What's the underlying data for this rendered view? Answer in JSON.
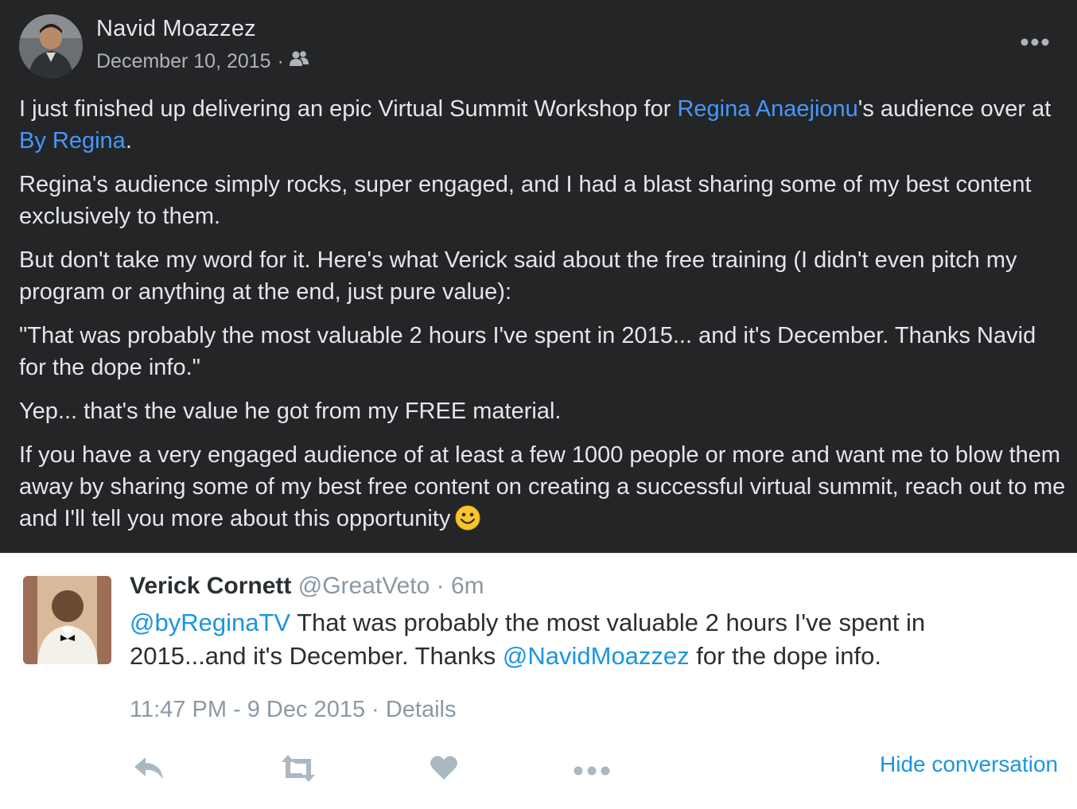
{
  "post": {
    "author": "Navid Moazzez",
    "date": "December 10, 2015",
    "date_separator": "·",
    "audience_icon": "friends-icon",
    "more_icon": "more-options-icon",
    "body": {
      "p1_a": "I just finished up delivering an epic Virtual Summit Workshop for ",
      "p1_link1": "Regina Anaejionu",
      "p1_b": "'s audience over at ",
      "p1_link2": "By Regina",
      "p1_c": ".",
      "p2": "Regina's audience simply rocks, super engaged, and I had a blast sharing some of my best content exclusively to them.",
      "p3": "But don't take my word for it. Here's what Verick said about the free training (I didn't even pitch my program or anything at the end, just pure value):",
      "p4": "\"That was probably the most valuable 2 hours I've spent in 2015... and it's December. Thanks Navid for the dope info.\"",
      "p5": "Yep... that's the value he got from my FREE material.",
      "p6": "If you have a very engaged audience of at least a few 1000 people or more and want me to blow them away by sharing some of my best free content on creating a successful virtual summit, reach out to me and I'll tell you more about this opportunity",
      "emoji_icon": "smiley-emoji-icon"
    },
    "colors": {
      "background": "#242526",
      "text": "#e4e6eb",
      "secondary": "#b0b3b8",
      "link": "#4599ff"
    }
  },
  "tweet": {
    "name": "Verick Cornett",
    "handle": "@GreatVeto",
    "separator": "·",
    "time_ago": "6m",
    "mention1": "@byReginaTV",
    "text_a": " That was probably the most valuable 2 hours I've spent in 2015...and it's December. Thanks ",
    "mention2": "@NavidMoazzez",
    "text_b": " for the dope info.",
    "timestamp": "11:47 PM - 9 Dec 2015 · Details",
    "actions": [
      "reply-icon",
      "retweet-icon",
      "like-icon",
      "more-icon"
    ],
    "hide_conversation": "Hide conversation",
    "colors": {
      "name": "#292f33",
      "muted": "#8899a6",
      "link": "#1b95e0",
      "icon": "#aab8c2"
    }
  }
}
